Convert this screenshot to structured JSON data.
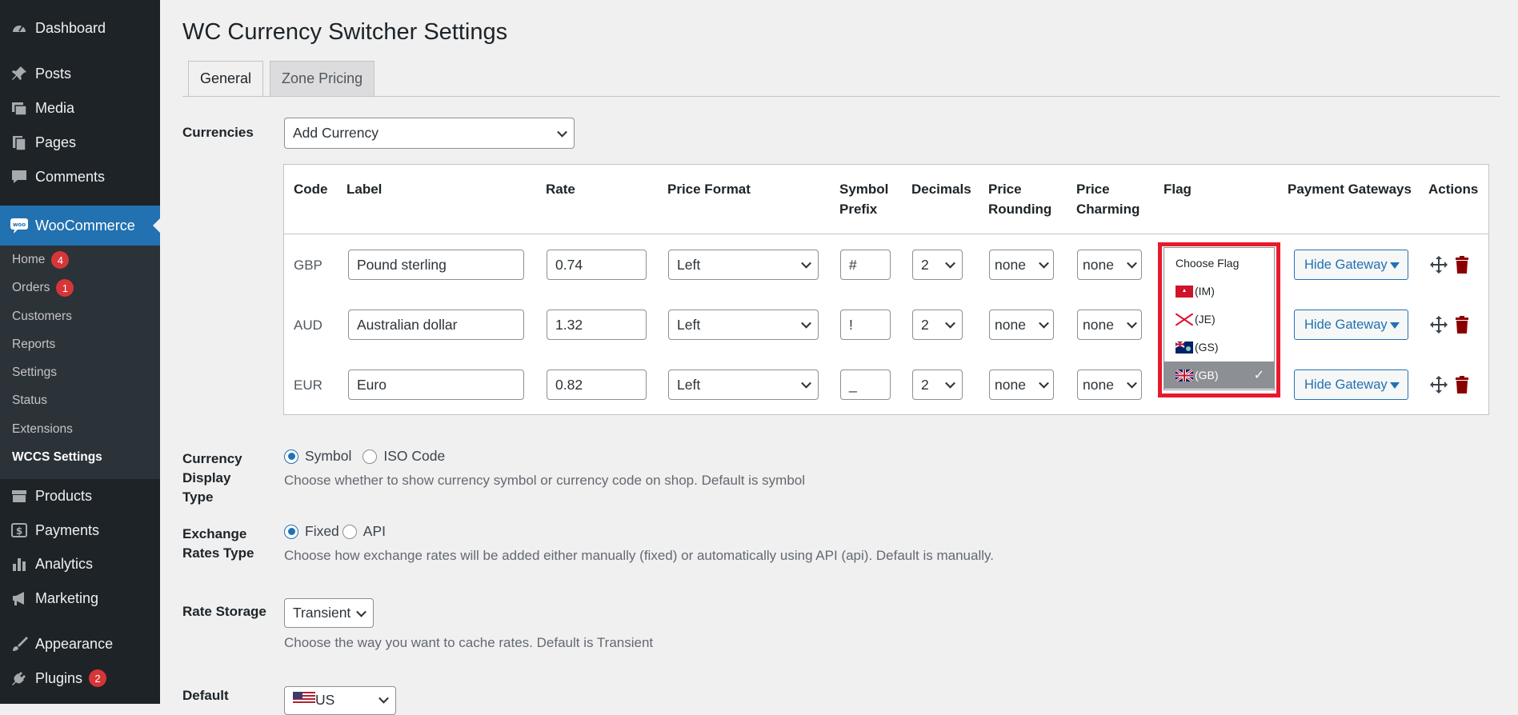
{
  "sidebar": {
    "items": [
      {
        "label": "Dashboard",
        "icon": "dashboard-icon"
      },
      {
        "label": "Posts",
        "icon": "pin-icon"
      },
      {
        "label": "Media",
        "icon": "media-icon"
      },
      {
        "label": "Pages",
        "icon": "pages-icon"
      },
      {
        "label": "Comments",
        "icon": "comment-icon"
      },
      {
        "label": "WooCommerce",
        "icon": "woo-icon"
      },
      {
        "label": "Products",
        "icon": "archive-icon"
      },
      {
        "label": "Payments",
        "icon": "dollar-icon"
      },
      {
        "label": "Analytics",
        "icon": "chart-bar-icon"
      },
      {
        "label": "Marketing",
        "icon": "megaphone-icon"
      },
      {
        "label": "Appearance",
        "icon": "brush-icon"
      },
      {
        "label": "Plugins",
        "icon": "plug-icon",
        "badge": "2"
      }
    ],
    "woo_submenu": [
      {
        "label": "Home",
        "badge": "4"
      },
      {
        "label": "Orders",
        "badge": "1"
      },
      {
        "label": "Customers"
      },
      {
        "label": "Reports"
      },
      {
        "label": "Settings"
      },
      {
        "label": "Status"
      },
      {
        "label": "Extensions"
      },
      {
        "label": "WCCS Settings"
      }
    ]
  },
  "page": {
    "title": "WC Currency Switcher Settings",
    "tabs": [
      "General",
      "Zone Pricing"
    ]
  },
  "currencies": {
    "label": "Currencies",
    "add_select": "Add Currency",
    "columns": [
      "Code",
      "Label",
      "Rate",
      "Price Format",
      "Symbol Prefix",
      "Decimals",
      "Price Rounding",
      "Price Charming",
      "Flag",
      "Payment Gateways",
      "Actions"
    ],
    "rows": [
      {
        "code": "GBP",
        "label": "Pound sterling",
        "rate": "0.74",
        "format": "Left",
        "prefix": "#",
        "decimals": "2",
        "rounding": "none",
        "charming": "none",
        "gateway": "Hide Gateway"
      },
      {
        "code": "AUD",
        "label": "Australian dollar",
        "rate": "1.32",
        "format": "Left",
        "prefix": "!",
        "decimals": "2",
        "rounding": "none",
        "charming": "none",
        "gateway": "Hide Gateway"
      },
      {
        "code": "EUR",
        "label": "Euro",
        "rate": "0.82",
        "format": "Left",
        "prefix": "_",
        "decimals": "2",
        "rounding": "none",
        "charming": "none",
        "gateway": "Hide Gateway"
      }
    ],
    "flag_dropdown": {
      "options": [
        "Choose Flag",
        "(IM)",
        "(JE)",
        "(GS)",
        "(GB)"
      ],
      "selected": "(GB)",
      "check_glyph": "✓"
    }
  },
  "display_type": {
    "label": "Currency Display Type",
    "options": [
      "Symbol",
      "ISO Code"
    ],
    "selected": "Symbol",
    "desc": "Choose whether to show currency symbol or currency code on shop. Default is symbol"
  },
  "exchange_type": {
    "label": "Exchange Rates Type",
    "options": [
      "Fixed",
      "API"
    ],
    "selected": "Fixed",
    "desc": "Choose how exchange rates will be added either manually (fixed) or automatically using API (api). Default is manually."
  },
  "rate_storage": {
    "label": "Rate Storage",
    "value": "Transient",
    "desc": "Choose the way you want to cache rates. Default is Transient"
  },
  "default_currency": {
    "label": "Default",
    "value": "US"
  },
  "colors": {
    "sidebar_bg": "#1d2327",
    "accent": "#2271b1",
    "highlight_box": "#e8192c",
    "trash": "#8a0000"
  }
}
